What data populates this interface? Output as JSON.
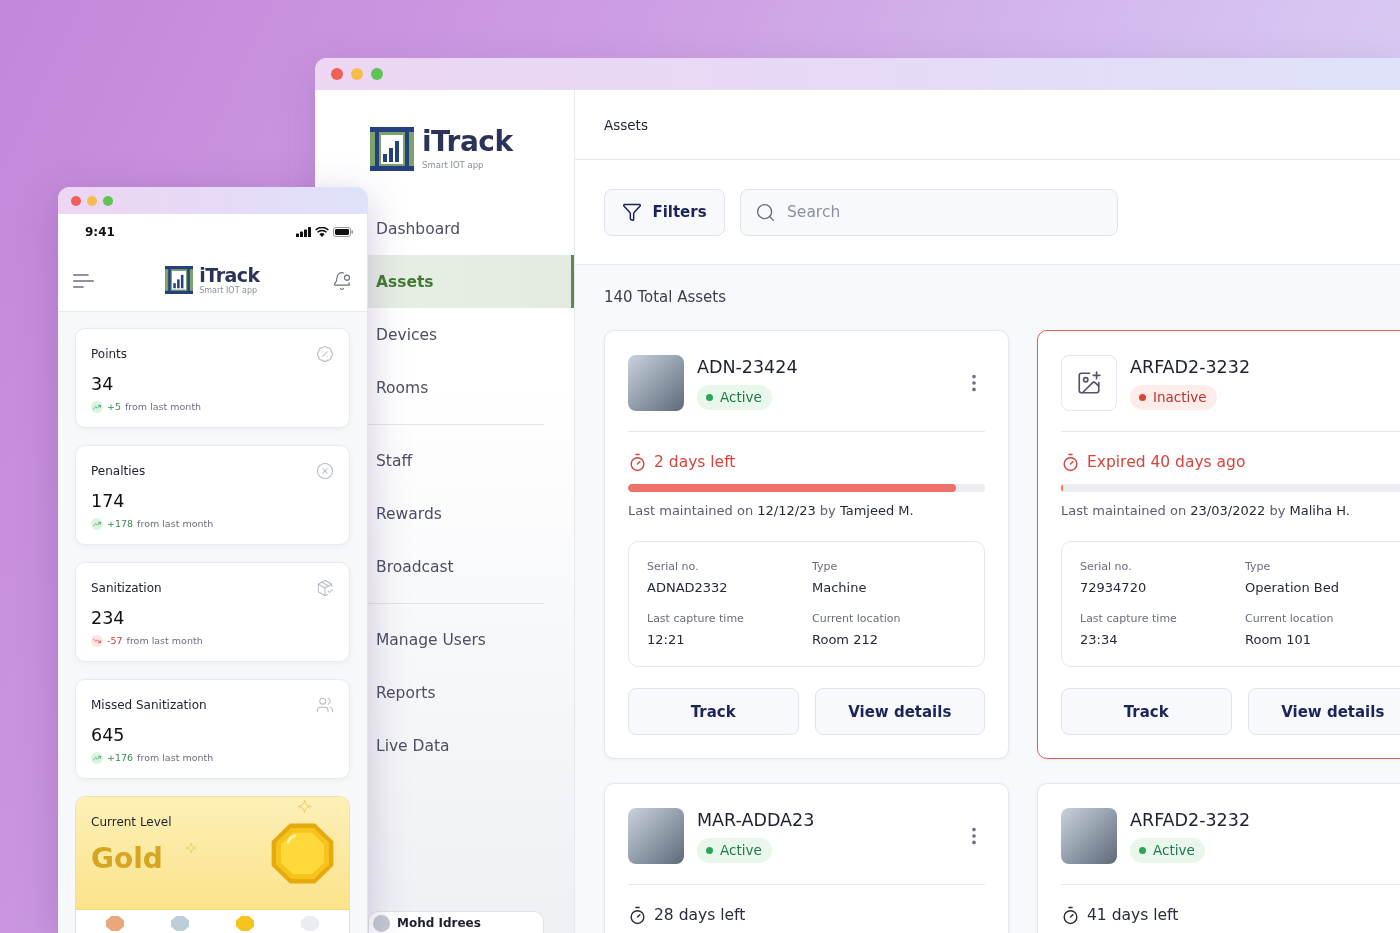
{
  "desktop": {
    "sidebar": {
      "brand": {
        "name": "iTrack",
        "tagline": "Smart IOT app"
      },
      "nav_groups": [
        {
          "items": [
            {
              "label": "Dashboard",
              "selected": false
            },
            {
              "label": "Assets",
              "selected": true
            },
            {
              "label": "Devices",
              "selected": false
            },
            {
              "label": "Rooms",
              "selected": false
            }
          ]
        },
        {
          "items": [
            {
              "label": "Staff",
              "selected": false
            },
            {
              "label": "Rewards",
              "selected": false
            },
            {
              "label": "Broadcast",
              "selected": false
            }
          ]
        },
        {
          "items": [
            {
              "label": "Manage Users",
              "selected": false
            },
            {
              "label": "Reports",
              "selected": false
            },
            {
              "label": "Live Data",
              "selected": false
            }
          ]
        }
      ],
      "user": {
        "name": "Mohd Idrees"
      }
    },
    "header": {
      "title": "Assets"
    },
    "toolbar": {
      "filter_button": "Filters",
      "search": {
        "placeholder": "Search"
      }
    },
    "summary": "140 Total Assets",
    "assets": [
      {
        "name": "ADN-23424",
        "photo": true,
        "status": "Active",
        "active": true,
        "menu": true,
        "expired": false,
        "due": "2 days left",
        "alert": true,
        "level": 0.92,
        "last_maintained": "Last maintained on **12/12/23** by **Tamjeed M.**",
        "details": [
          {
            "label": "Serial no.",
            "value": "ADNAD2332"
          },
          {
            "label": "Type",
            "value": "Machine"
          },
          {
            "label": "Last capture time",
            "value": "12:21"
          },
          {
            "label": "Current location",
            "value": "Room 212"
          }
        ],
        "actions": [
          "Track",
          "View details"
        ]
      },
      {
        "name": "ARFAD2-3232",
        "photo": false,
        "status": "Inactive",
        "active": false,
        "expired": true,
        "due": "Expired 40 days ago",
        "alert": true,
        "level": 0,
        "last_maintained": "Last maintained on **23/03/2022** by **Maliha H.**",
        "details": [
          {
            "label": "Serial no.",
            "value": "72934720"
          },
          {
            "label": "Type",
            "value": "Operation Bed"
          },
          {
            "label": "Last capture time",
            "value": "23:34"
          },
          {
            "label": "Current location",
            "value": "Room 101"
          }
        ],
        "actions": [
          "Track",
          "View details"
        ]
      },
      {
        "name": "MAR-ADDA23",
        "photo": true,
        "status": "Active",
        "active": true,
        "menu": true,
        "expired": false,
        "due": "28 days left",
        "alert": false
      },
      {
        "name": "ARFAD2-3232",
        "photo": true,
        "status": "Active",
        "active": true,
        "expired": false,
        "due": "41 days left",
        "alert": false
      }
    ]
  },
  "mobile": {
    "status_bar": {
      "time": "9:41"
    },
    "brand": {
      "name": "iTrack",
      "tagline": "Smart IOT app"
    },
    "stats": [
      {
        "label": "Points",
        "value": "34",
        "change": "+5",
        "note": "from last month",
        "increase": true
      },
      {
        "label": "Penalties",
        "value": "174",
        "change": "+178",
        "note": "from last month",
        "increase": true
      },
      {
        "label": "Sanitization",
        "value": "234",
        "change": "-57",
        "note": "from last month",
        "increase": false
      },
      {
        "label": "Missed Sanitization",
        "value": "645",
        "change": "+176",
        "note": "from last month",
        "increase": true
      }
    ],
    "level_card": {
      "label": "Current Level",
      "value": "Gold"
    },
    "medals": [
      {
        "color": "#e8a87c"
      },
      {
        "color": "#bccfd8"
      },
      {
        "color": "#f5c41e"
      },
      {
        "color": "#e9ecf1"
      }
    ]
  }
}
